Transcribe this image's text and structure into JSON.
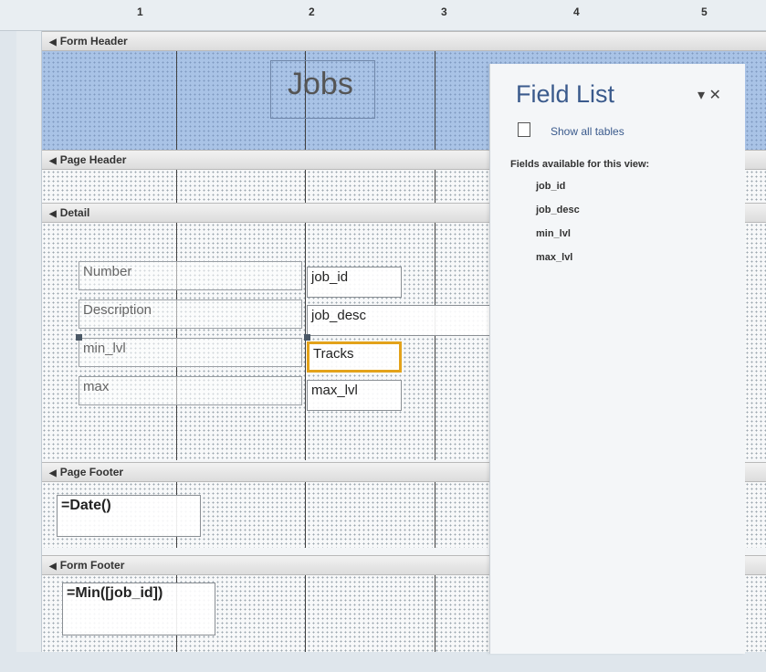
{
  "ruler": {
    "marks": [
      "1",
      "2",
      "3",
      "4",
      "5"
    ]
  },
  "sections": {
    "form_header": "Form Header",
    "page_header": "Page Header",
    "detail": "Detail",
    "page_footer": "Page Footer",
    "form_footer": "Form Footer"
  },
  "header_title": "Jobs",
  "detail_controls": {
    "labels": [
      "Number",
      "Description",
      "min_lvl",
      "max"
    ],
    "fields": [
      "job_id",
      "job_desc",
      "Tracks",
      "max_lvl"
    ]
  },
  "page_footer_control": "=Date()",
  "form_footer_control": "=Min([job_id])",
  "field_list": {
    "title": "Field List",
    "controls": "▾ ✕",
    "show_all": "Show all tables",
    "subheading": "Fields available for this view:",
    "fields": [
      "job_id",
      "job_desc",
      "min_lvl",
      "max_lvl"
    ]
  },
  "colors": {
    "header_fill": "#a9c3e6",
    "selection": "#e3a21a",
    "pane_title": "#3a5a8c"
  }
}
